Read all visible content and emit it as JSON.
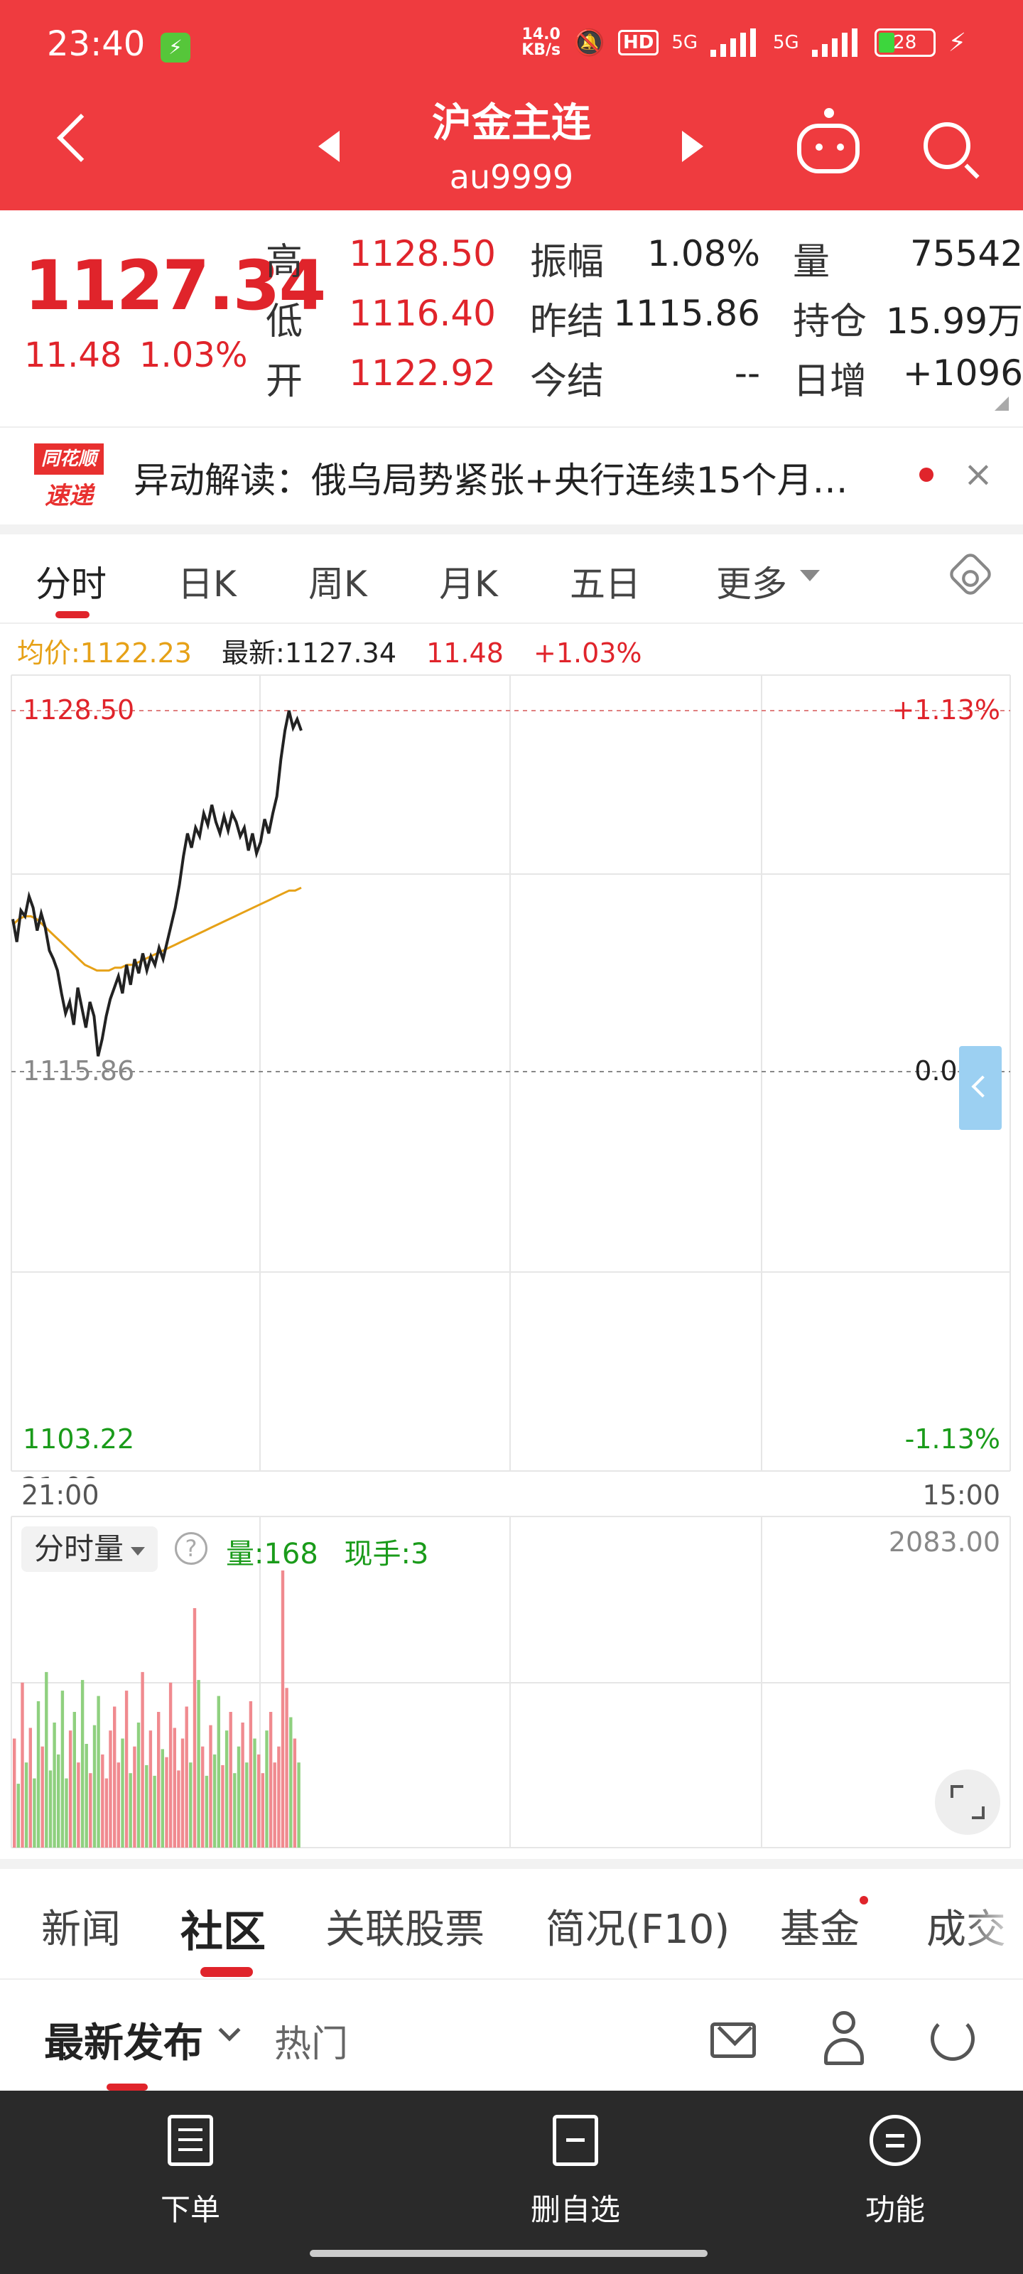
{
  "status_bar": {
    "time": "23:40",
    "net_speed": "14.0\nKB/s",
    "hd": "HD",
    "net1": "5G",
    "net2": "5G",
    "battery": "28"
  },
  "header": {
    "title": "沪金主连",
    "code": "au9999"
  },
  "quote": {
    "last_price": "1127.34",
    "change": "11.48",
    "change_pct": "1.03%",
    "rows": [
      {
        "l1": "高",
        "v1": "1128.50",
        "l2": "振幅",
        "v2": "1.08%",
        "l3": "量",
        "v3": "75542"
      },
      {
        "l1": "低",
        "v1": "1116.40",
        "l2": "昨结",
        "v2": "1115.86",
        "l3": "持仓",
        "v3": "15.99万"
      },
      {
        "l1": "开",
        "v1": "1122.92",
        "l2": "今结",
        "v2": "--",
        "l3": "日增",
        "v3": "+1096"
      }
    ]
  },
  "news": {
    "logo_top": "同花顺",
    "logo_bottom": "速递",
    "text": "异动解读：俄乌局势紧张+央行连续15个月…",
    "close": "×"
  },
  "chart_tabs": {
    "items": [
      "分时",
      "日K",
      "周K",
      "月K",
      "五日",
      "更多"
    ]
  },
  "chart_info": {
    "avg": "均价:1122.23",
    "latest": "最新:1127.34",
    "change": "11.48",
    "pct": "+1.03%"
  },
  "chart_labels": {
    "top_price": "1128.50",
    "top_pct": "+1.13%",
    "mid_price": "1115.86",
    "mid_pct": "0.00%",
    "bottom_price": "1103.22",
    "bottom_pct": "-1.13%",
    "time_start": "21:00",
    "time_end": "15:00"
  },
  "volume": {
    "tag": "分时量",
    "help": "?",
    "qty": "量:168",
    "now": "现手:3",
    "max": "2083.00"
  },
  "bottom_tabs": {
    "items": [
      "新闻",
      "社区",
      "关联股票",
      "简况(F10)",
      "基金",
      "成交"
    ]
  },
  "sub_tabs": {
    "latest": "最新发布",
    "hot": "热门"
  },
  "bottom_nav": {
    "order": "下单",
    "delete": "删自选",
    "func": "功能"
  },
  "colors": {
    "header_red": "#ef3b3f",
    "up_red": "#e0242b",
    "down_green": "#1a9b1a",
    "avg_line": "#e6a117",
    "price_line": "#222222"
  },
  "chart_data": {
    "type": "line",
    "prev_settle": 1115.86,
    "ylim": [
      1103.22,
      1128.5
    ],
    "x_labels": [
      "21:00",
      "15:00"
    ],
    "series": [
      {
        "name": "最新",
        "values": [
          1121.2,
          1120.4,
          1121.5,
          1121.3,
          1122.0,
          1121.6,
          1120.8,
          1121.4,
          1120.9,
          1120.1,
          1119.8,
          1119.4,
          1118.6,
          1117.9,
          1118.3,
          1117.5,
          1118.8,
          1118.1,
          1117.4,
          1118.3,
          1117.8,
          1116.4,
          1117.0,
          1117.8,
          1118.4,
          1118.8,
          1119.2,
          1118.6,
          1119.6,
          1118.9,
          1119.8,
          1119.3,
          1120.0,
          1119.4,
          1119.9,
          1119.6,
          1120.2,
          1119.8,
          1120.4,
          1121.0,
          1121.6,
          1122.4,
          1123.4,
          1124.2,
          1123.7,
          1124.4,
          1124.1,
          1124.9,
          1124.5,
          1125.2,
          1124.6,
          1124.2,
          1124.8,
          1124.3,
          1124.9,
          1124.6,
          1124.1,
          1124.4,
          1123.6,
          1124.2,
          1123.5,
          1123.9,
          1124.7,
          1124.2,
          1124.9,
          1125.5,
          1126.8,
          1127.8,
          1128.5,
          1127.9,
          1128.2,
          1127.8
        ]
      },
      {
        "name": "均价",
        "values": [
          1121.0,
          1121.2,
          1121.3,
          1121.3,
          1121.2,
          1121.0,
          1120.8,
          1120.6,
          1120.4,
          1120.2,
          1120.0,
          1119.8,
          1119.6,
          1119.5,
          1119.4,
          1119.4,
          1119.4,
          1119.5,
          1119.5,
          1119.6,
          1119.6,
          1119.7,
          1119.8,
          1119.9,
          1120.0,
          1120.1,
          1120.2,
          1120.3,
          1120.4,
          1120.5,
          1120.6,
          1120.7,
          1120.8,
          1120.9,
          1121.0,
          1121.1,
          1121.2,
          1121.3,
          1121.4,
          1121.5,
          1121.6,
          1121.7,
          1121.8,
          1121.9,
          1122.0,
          1122.1,
          1122.2,
          1122.2,
          1122.3
        ]
      }
    ],
    "volume": [
      820,
      480,
      1240,
      640,
      900,
      520,
      1100,
      760,
      1320,
      580,
      940,
      700,
      1180,
      520,
      880,
      1020,
      640,
      1260,
      780,
      560,
      920,
      1140,
      700,
      520,
      880,
      1060,
      640,
      820,
      1180,
      560,
      760,
      940,
      1320,
      620,
      880,
      540,
      1020,
      740,
      680,
      1240,
      900,
      580,
      820,
      1060,
      640,
      1800,
      1260,
      760,
      540,
      920,
      700,
      1140,
      620,
      880,
      1020,
      560,
      760,
      940,
      640,
      1100,
      820,
      700,
      560,
      880,
      1020,
      640,
      760,
      2083,
      1200,
      980,
      820,
      640
    ]
  }
}
